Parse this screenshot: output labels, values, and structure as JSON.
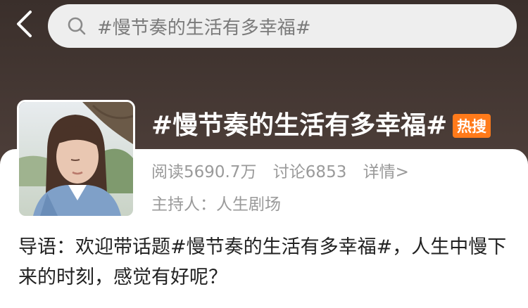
{
  "search": {
    "query": "#慢节奏的生活有多幸福#"
  },
  "topic": {
    "title": "#慢节奏的生活有多幸福#",
    "badge": "热搜",
    "reads": "阅读5690.7万",
    "discussions": "讨论6853",
    "detail_link": "详情>",
    "host": "主持人：人生剧场",
    "intro": "导语：欢迎带话题#慢节奏的生活有多幸福#，人生中慢下来的时刻，感觉有好呢？"
  },
  "colors": {
    "badge": "#ff7a1a",
    "header_bg": "#3a2f2b",
    "search_bg": "#eeeeee",
    "secondary_text": "#9a9a9a"
  },
  "icons": {
    "back": "chevron-left-icon",
    "search": "search-icon"
  }
}
